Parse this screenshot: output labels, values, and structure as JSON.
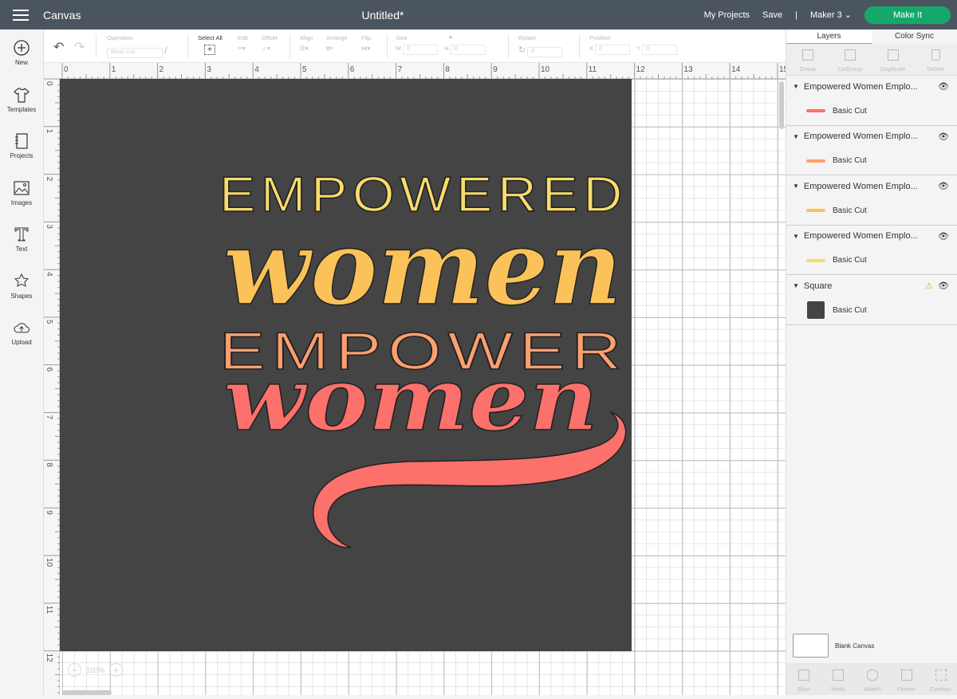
{
  "topbar": {
    "app": "Canvas",
    "title": "Untitled*",
    "my_projects": "My Projects",
    "save": "Save",
    "divider": "|",
    "machine": "Maker 3",
    "make_it": "Make It"
  },
  "sidebar": [
    {
      "label": "New",
      "icon": "plus-circle-icon"
    },
    {
      "label": "Templates",
      "icon": "tshirt-icon"
    },
    {
      "label": "Projects",
      "icon": "notebook-icon"
    },
    {
      "label": "Images",
      "icon": "image-icon"
    },
    {
      "label": "Text",
      "icon": "text-icon"
    },
    {
      "label": "Shapes",
      "icon": "shapes-icon"
    },
    {
      "label": "Upload",
      "icon": "cloud-upload-icon"
    }
  ],
  "toolbar": {
    "operation_label": "Operation",
    "operation_value": "Basic Cut",
    "select_all": "Select All",
    "edit": "Edit",
    "offset": "Offset",
    "align": "Align",
    "arrange": "Arrange",
    "flip": "Flip",
    "size": "Size",
    "w": "W",
    "w_value": "0",
    "h": "H",
    "h_value": "0",
    "rotate": "Rotate",
    "rotate_value": "0",
    "position": "Position",
    "x": "X",
    "x_value": "0",
    "y": "Y",
    "y_value": "0"
  },
  "ruler": {
    "top": [
      "0",
      "1",
      "2",
      "3",
      "4",
      "5",
      "6",
      "7",
      "8",
      "9",
      "10",
      "11",
      "12",
      "13",
      "14",
      "15"
    ],
    "left": [
      "0",
      "1",
      "2",
      "3",
      "4",
      "5",
      "6",
      "7",
      "8",
      "9",
      "10",
      "11",
      "12"
    ]
  },
  "design": {
    "line1": "EMPOWERED",
    "line2": "women",
    "line3": "EMPOWER",
    "line4": "women",
    "colors": {
      "line1": "#f9dc6b",
      "line2": "#fcc25a",
      "line3": "#fc9f6f",
      "line4": "#fc716b",
      "mat": "#444444"
    }
  },
  "zoom": {
    "level": "100%",
    "minus": "−",
    "plus": "+"
  },
  "panel": {
    "tabs": [
      "Layers",
      "Color Sync"
    ],
    "actions": [
      "Group",
      "UnGroup",
      "Duplicate",
      "Delete"
    ],
    "layers": [
      {
        "name": "Empowered Women Emplo...",
        "sub": "Basic Cut",
        "color": "#fc716b"
      },
      {
        "name": "Empowered Women Emplo...",
        "sub": "Basic Cut",
        "color": "#fc9f6f"
      },
      {
        "name": "Empowered Women Emplo...",
        "sub": "Basic Cut",
        "color": "#fcc25a"
      },
      {
        "name": "Empowered Women Emplo...",
        "sub": "Basic Cut",
        "color": "#f9dc6b"
      },
      {
        "name": "Square",
        "sub": "Basic Cut",
        "color": "#444444",
        "warning": true
      }
    ],
    "blank_canvas": "Blank Canvas",
    "bottom_actions": [
      "Slice",
      "Weld",
      "Attach",
      "Flatten",
      "Contour"
    ]
  },
  "colors": {
    "topbar": "#4b5560",
    "make_it": "#14a96b"
  }
}
